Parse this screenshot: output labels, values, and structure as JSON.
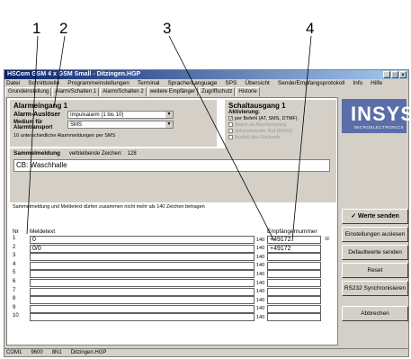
{
  "callouts": [
    "1",
    "2",
    "3",
    "4"
  ],
  "window": {
    "title": "HSCom GSM 4 x GSM Small - Ditzingen.HGP",
    "menu": [
      "Datei",
      "Schnittstelle",
      "Programmeinstellungen",
      "Terminal",
      "Sprache/Language",
      "SPS",
      "Übersicht",
      "Sende/Empfangsprotokoll",
      "Info",
      "Hilfe"
    ],
    "tabs": [
      "Grundeinstellung",
      "Alarm/Schalten 1",
      "Alarm/Schalten 2",
      "weitere Empfänger",
      "Zugriffschutz",
      "Historie"
    ]
  },
  "alarm": {
    "title": "Alarmeingang 1",
    "ausloeser_label": "Alarm-Auslöser",
    "ausloeser_value": "Impulsalarm (1 bis 10)",
    "medium_label": "Medium für Alarmtransport",
    "medium_value": "SMS",
    "info": "10 unterschiedliche Alarmmeldungen per SMS"
  },
  "schalt": {
    "title": "Schaltausgang 1",
    "aktiv_label": "Aktivierung:",
    "options": [
      {
        "label": "per Befehl (AT, SMS, DTMF)",
        "checked": true,
        "enabled": true
      },
      {
        "label": "Alarm an Alarmeingang",
        "checked": false,
        "enabled": false
      },
      {
        "label": "ankommender Ruf (RING)",
        "checked": false,
        "enabled": false
      },
      {
        "label": "Ausfall des Funknetz",
        "checked": false,
        "enabled": false
      }
    ]
  },
  "meldung": {
    "title": "Sammelmeldung",
    "remaining_label": "verbleibende Zeichen:",
    "remaining": "128",
    "text": "CB: Waschhalle",
    "note": "Sammelmeldung und Meldetext dürfen zusammen nicht mehr als 140 Zeichen betragen"
  },
  "table": {
    "col_nr": "Nr",
    "col_text": "Meldetext",
    "col_num": "Empfängernummer",
    "rows": [
      {
        "nr": "1",
        "text": "0",
        "count": "140",
        "number": "+49172"
      },
      {
        "nr": "2",
        "text": "0/0",
        "count": "140",
        "number": "+49172"
      },
      {
        "nr": "3",
        "text": "",
        "count": "140",
        "number": ""
      },
      {
        "nr": "4",
        "text": "",
        "count": "140",
        "number": ""
      },
      {
        "nr": "5",
        "text": "",
        "count": "140",
        "number": ""
      },
      {
        "nr": "6",
        "text": "",
        "count": "140",
        "number": ""
      },
      {
        "nr": "7",
        "text": "",
        "count": "140",
        "number": ""
      },
      {
        "nr": "8",
        "text": "",
        "count": "140",
        "number": ""
      },
      {
        "nr": "9",
        "text": "",
        "count": "140",
        "number": ""
      },
      {
        "nr": "10",
        "text": "",
        "count": "140",
        "number": ""
      }
    ]
  },
  "logo": {
    "main": "INSYS",
    "sub": "MICROELECTRONICS"
  },
  "buttons": {
    "send": "✓ Werte senden",
    "read": "Einstellungen auslesen",
    "default": "Defaultwerte senden",
    "reset": "Reset",
    "sync": "RS232 Synchronisieren",
    "cancel": "Abbrechen"
  },
  "status": [
    "COM1",
    "9600",
    "8N1",
    "Ditzingen.HGP"
  ]
}
